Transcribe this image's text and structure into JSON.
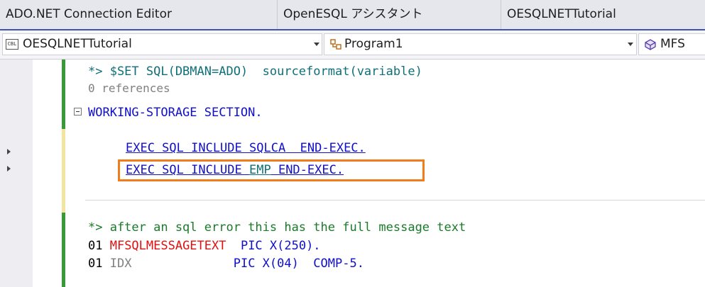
{
  "tabs": [
    {
      "label": "ADO.NET Connection Editor"
    },
    {
      "label": "OpenESQL アシスタント"
    },
    {
      "label": "OESQLNETTutorial"
    }
  ],
  "navbar": {
    "project": "OESQLNETTutorial",
    "project_icon_text": "CBL",
    "class": "Program1",
    "member": "MFS"
  },
  "code": {
    "directive": "*> $SET SQL(DBMAN=ADO)  sourceformat(variable)",
    "references": "0 references",
    "working_storage": "WORKING-STORAGE SECTION.",
    "exec_sqlca_a": "EXEC SQL INCLUDE ",
    "exec_sqlca_b": "SQLCA",
    "exec_sqlca_c": "  END-EXEC.",
    "exec_emp_a": "EXEC SQL INCLUDE ",
    "exec_emp_b": "EMP",
    "exec_emp_c": " END-EXEC.",
    "comment": "*> after an sql error this has the full message text",
    "msg_level": "01 ",
    "msg_name": "MFSQLMESSAGETEXT",
    "msg_pic": "  PIC X(250).",
    "idx_level": "01 ",
    "idx_name": "IDX",
    "idx_pic": "              PIC X(04)  COMP-5."
  },
  "colors": {
    "accent": "#3e56b0",
    "highlight": "#f07c1c",
    "keyword": "#1010c8",
    "comment": "#1a7a2a",
    "error_name": "#e01010"
  }
}
